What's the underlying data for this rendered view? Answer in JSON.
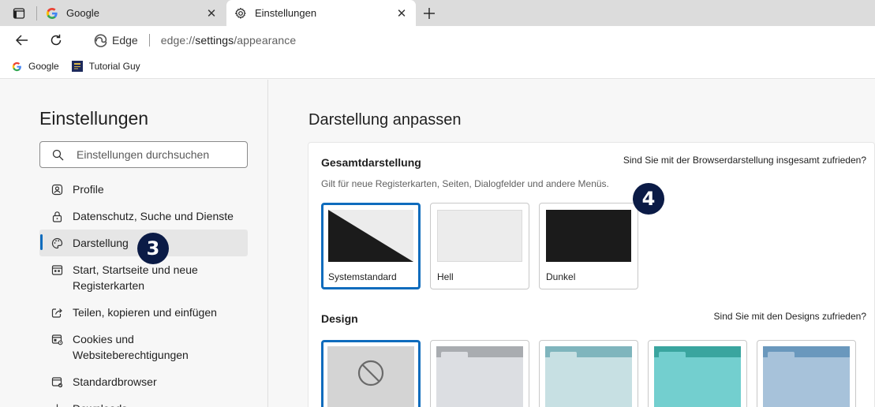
{
  "tabs": [
    {
      "title": "Google",
      "active": false,
      "icon": "google-g-icon"
    },
    {
      "title": "Einstellungen",
      "active": true,
      "icon": "gear-icon"
    }
  ],
  "address": {
    "edge_label": "Edge",
    "url_prefix": "edge://",
    "url_highlight": "settings",
    "url_suffix": "/appearance"
  },
  "bookmarks": [
    {
      "label": "Google",
      "icon": "google-g-icon"
    },
    {
      "label": "Tutorial Guy",
      "icon": "tutorial-guy-icon"
    }
  ],
  "sidebar": {
    "title": "Einstellungen",
    "search_placeholder": "Einstellungen durchsuchen",
    "items": [
      {
        "label": "Profile",
        "icon": "profile-icon"
      },
      {
        "label": "Datenschutz, Suche und Dienste",
        "icon": "lock-icon"
      },
      {
        "label": "Darstellung",
        "icon": "palette-icon",
        "active": true
      },
      {
        "label": "Start, Startseite und neue Registerkarten",
        "icon": "start-page-icon"
      },
      {
        "label": "Teilen, kopieren und einfügen",
        "icon": "share-icon"
      },
      {
        "label": "Cookies und Websiteberechtigungen",
        "icon": "cookies-icon"
      },
      {
        "label": "Standardbrowser",
        "icon": "default-browser-icon"
      },
      {
        "label": "Downloads",
        "icon": "download-icon"
      }
    ]
  },
  "main": {
    "title": "Darstellung anpassen",
    "overall": {
      "title": "Gesamtdarstellung",
      "description": "Gilt für neue Registerkarten, Seiten, Dialogfelder und andere Menüs.",
      "feedback": "Sind Sie mit der Browserdarstellung insgesamt zufrieden?",
      "options": [
        {
          "label": "Systemstandard",
          "selected": true
        },
        {
          "label": "Hell",
          "selected": false
        },
        {
          "label": "Dunkel",
          "selected": false
        }
      ]
    },
    "design": {
      "title": "Design",
      "feedback": "Sind Sie mit den Designs zufrieden?",
      "options": [
        {
          "name": "none",
          "selected": true,
          "color": "#d4d4d4"
        },
        {
          "name": "grey",
          "selected": false,
          "color": "#dcdee2",
          "top": "#a9acb0"
        },
        {
          "name": "light-teal",
          "selected": false,
          "color": "#c7e0e3",
          "top": "#7fb5bd"
        },
        {
          "name": "teal",
          "selected": false,
          "color": "#73cfcf",
          "top": "#3aa59f"
        },
        {
          "name": "blue",
          "selected": false,
          "color": "#a7c2da",
          "top": "#6a98bd"
        }
      ]
    }
  },
  "annotations": [
    {
      "text": "3"
    },
    {
      "text": "4"
    }
  ],
  "colors": {
    "accent": "#0f6cbd",
    "badge": "#0b1b46"
  }
}
